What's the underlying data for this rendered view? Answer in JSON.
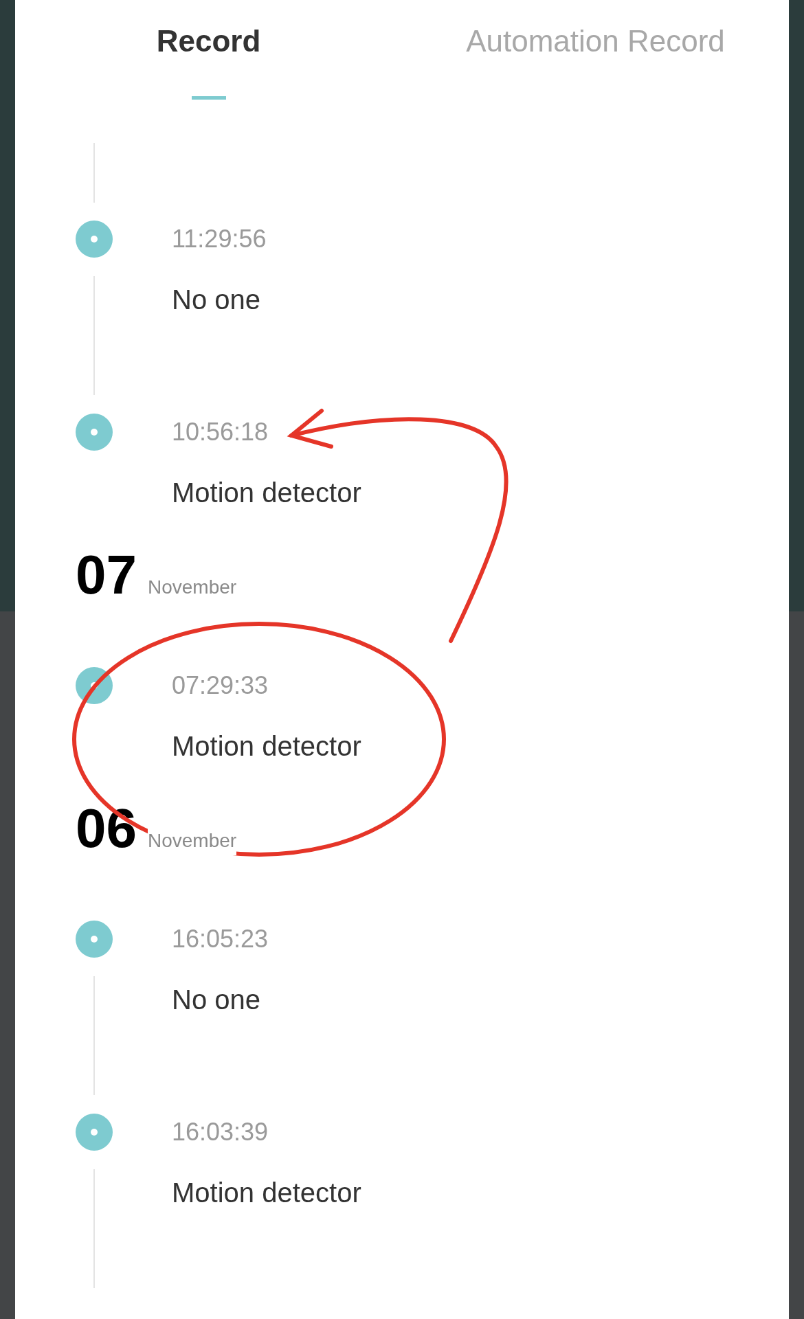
{
  "tabs": [
    {
      "label": "Record",
      "selected": true
    },
    {
      "label": "Automation Record",
      "selected": false
    }
  ],
  "days": [
    {
      "entries": [
        {
          "time": "11:29:56",
          "label": "No one"
        },
        {
          "time": "10:56:18",
          "label": "Motion detector"
        }
      ]
    },
    {
      "day": "07",
      "month": "November",
      "entries": [
        {
          "time": "07:29:33",
          "label": "Motion detector"
        }
      ]
    },
    {
      "day": "06",
      "month": "November",
      "entries": [
        {
          "time": "16:05:23",
          "label": "No one"
        },
        {
          "time": "16:03:39",
          "label": "Motion detector"
        }
      ]
    }
  ]
}
